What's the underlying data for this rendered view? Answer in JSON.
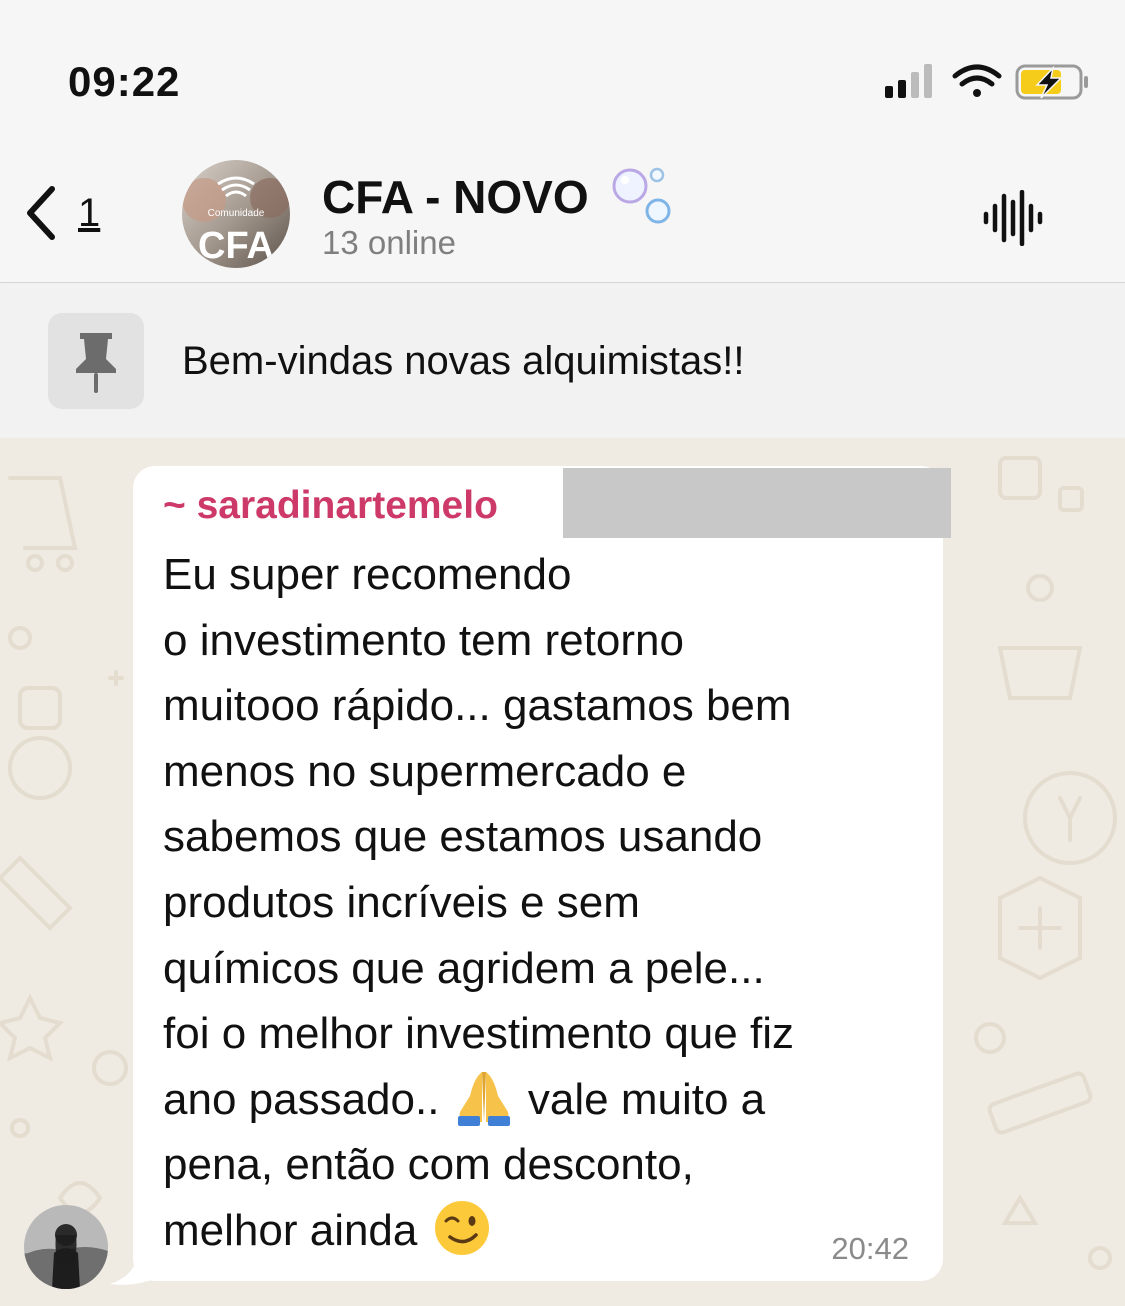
{
  "status_bar": {
    "time": "09:22",
    "icons": [
      "cellular-signal-icon",
      "wifi-icon",
      "battery-charging-icon"
    ]
  },
  "header": {
    "back_count": "1",
    "avatar_top_text": "Comunidade",
    "avatar_main_text": "CFA",
    "title": "CFA - NOVO",
    "subtitle": "13 online",
    "title_emoji": "bubbles-icon",
    "voice_icon": "voice-waveform-icon"
  },
  "pinned": {
    "icon": "pin-icon",
    "text": "Bem-vindas novas alquimistas!!"
  },
  "message": {
    "sender": "~ saradinartemelo",
    "text_part1": "Eu super recomendo\no investimento tem retorno\nmuitooo rápido... gastamos bem\nmenos no supermercado e\nsabemos que estamos usando\nprodutos incríveis e sem\nquímicos que agridem a pele...\nfoi o melhor investimento que fiz\nano passado.. ",
    "emoji1": "folded-hands-emoji",
    "text_part2": " vale muito a\npena, então com desconto,\nmelhor ainda ",
    "emoji2": "winking-face-emoji",
    "time": "20:42"
  },
  "colors": {
    "sender_name": "#cd3a6a",
    "chat_background": "#efeae2",
    "bubble": "#ffffff",
    "header_background": "#f6f6f6",
    "battery_fill": "#f5cc1a"
  }
}
